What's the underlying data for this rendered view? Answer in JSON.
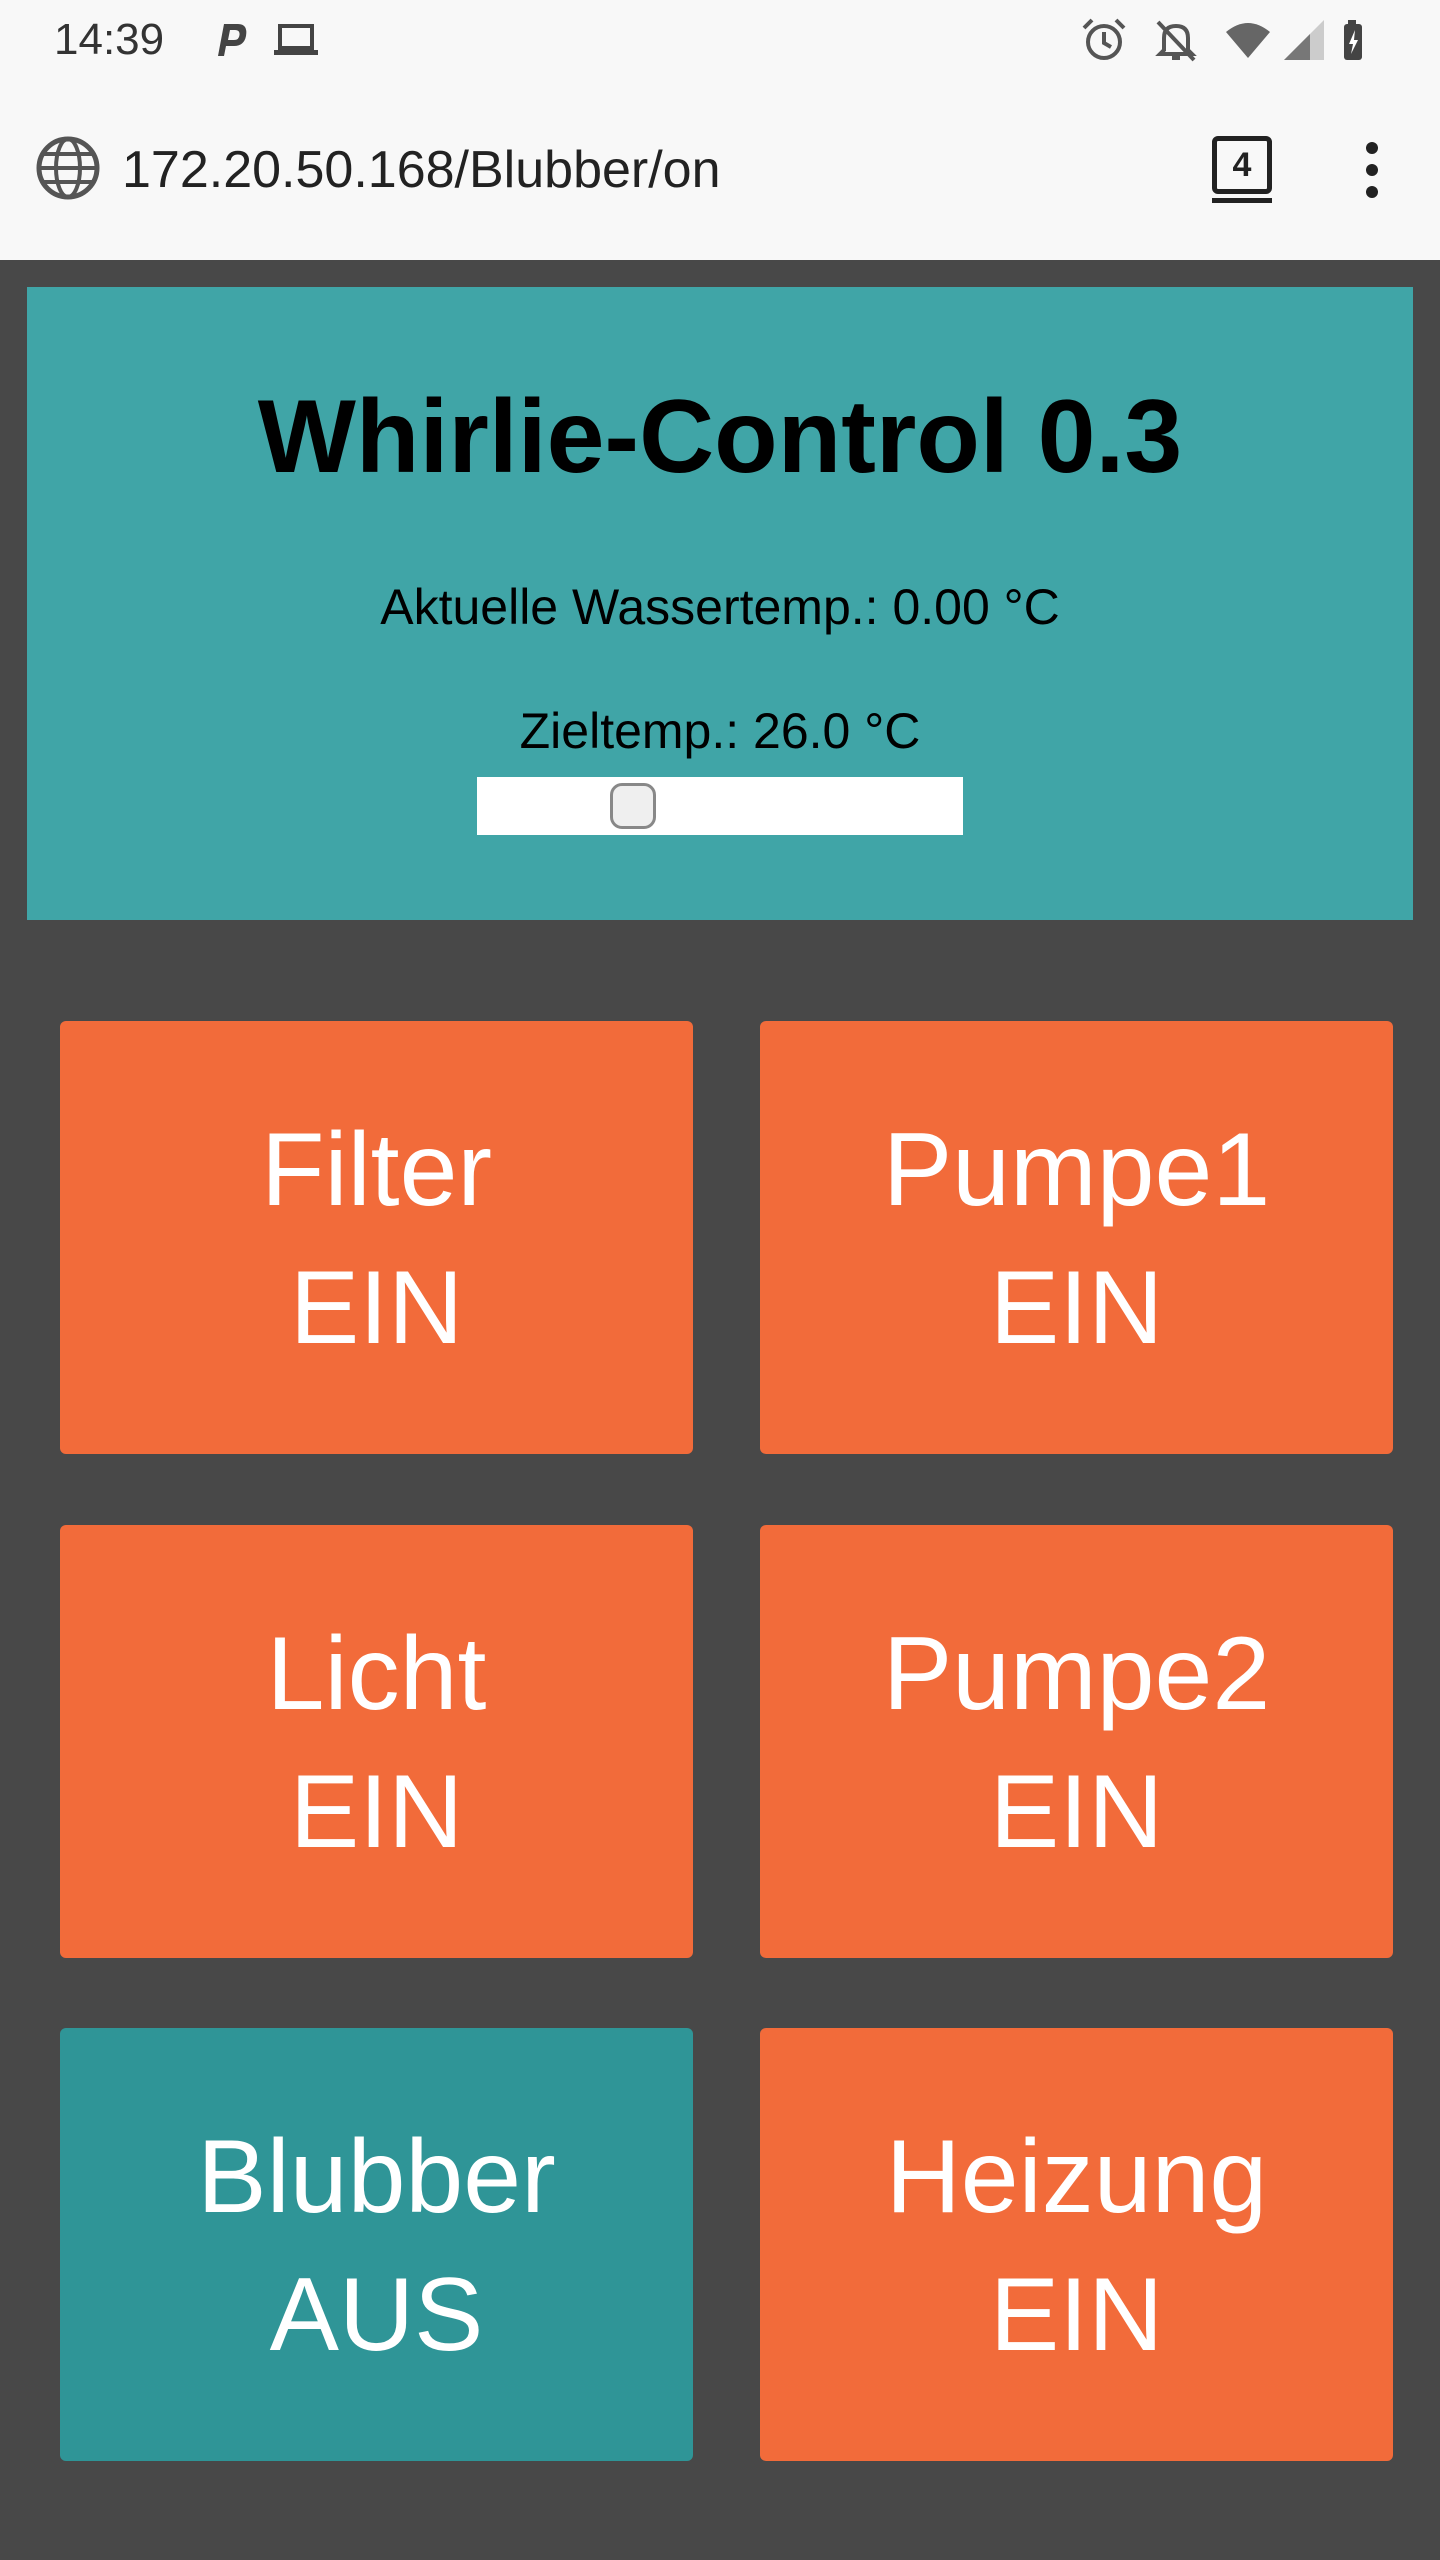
{
  "status_bar": {
    "time": "14:39"
  },
  "browser": {
    "url": "172.20.50.168/Blubber/on",
    "tab_count": "4"
  },
  "header": {
    "title": "Whirlie-Control 0.3",
    "water_temp": "Aktuelle Wassertemp.: 0.00 °C",
    "target_temp": "Zieltemp.: 26.0 °C",
    "slider_fraction": 0.32
  },
  "controls": [
    {
      "name": "Filter",
      "state": "EIN"
    },
    {
      "name": "Pumpe1",
      "state": "EIN"
    },
    {
      "name": "Licht",
      "state": "EIN"
    },
    {
      "name": "Pumpe2",
      "state": "EIN"
    },
    {
      "name": "Blubber",
      "state": "AUS"
    },
    {
      "name": "Heizung",
      "state": "EIN"
    }
  ],
  "colors": {
    "on": "#f26b3a",
    "off": "#2f9597",
    "header_bg": "#40a5a7",
    "page_bg": "#484848"
  }
}
